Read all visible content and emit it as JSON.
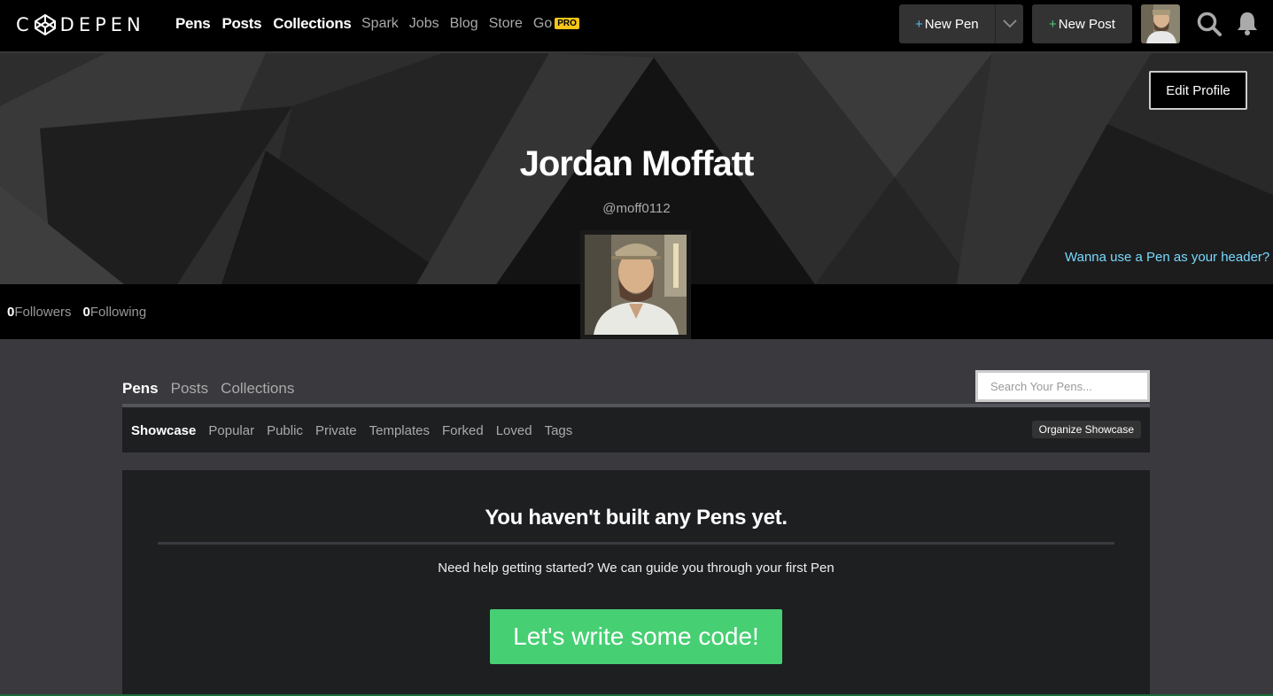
{
  "brand": {
    "logo_text": "DEPEN"
  },
  "nav": {
    "primary": [
      "Pens",
      "Posts",
      "Collections"
    ],
    "secondary": [
      "Spark",
      "Jobs",
      "Blog",
      "Store",
      "Go"
    ],
    "pro_badge": "PRO",
    "new_pen": "New Pen",
    "new_post": "New Post",
    "plus": "+"
  },
  "profile": {
    "edit_label": "Edit Profile",
    "name": "Jordan Moffatt",
    "handle": "@moff0112",
    "header_link": "Wanna use a Pen as your header?",
    "followers_count": "0",
    "followers_label": "Followers",
    "following_count": "0",
    "following_label": "Following"
  },
  "tabs": [
    "Pens",
    "Posts",
    "Collections"
  ],
  "search": {
    "placeholder": "Search Your Pens..."
  },
  "filters": [
    "Showcase",
    "Popular",
    "Public",
    "Private",
    "Templates",
    "Forked",
    "Loved",
    "Tags"
  ],
  "organize_label": "Organize Showcase",
  "empty": {
    "title": "You haven't built any Pens yet.",
    "subtitle": "Need help getting started? We can guide you through your first Pen",
    "cta": "Let's write some code!"
  },
  "colors": {
    "accent_green": "#47cf73",
    "link_blue": "#76daff",
    "pro_yellow": "#f5c518"
  }
}
